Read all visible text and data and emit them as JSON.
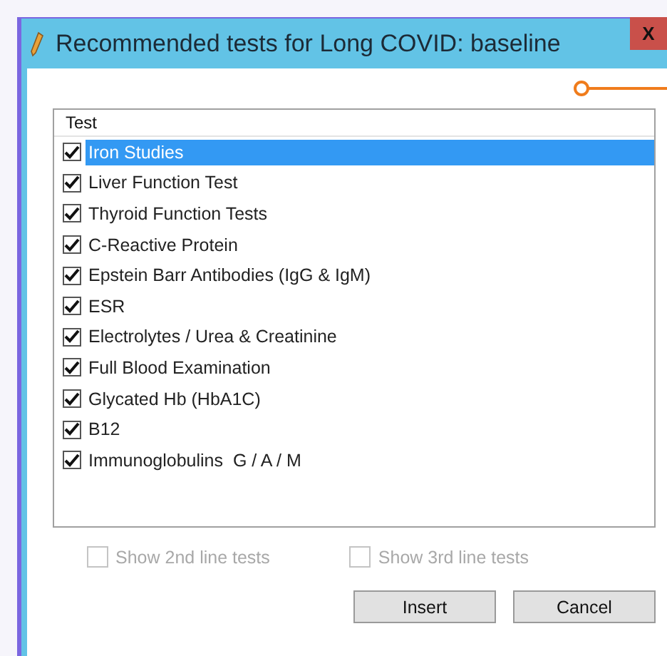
{
  "window": {
    "title": "Recommended tests for Long COVID: baseline",
    "close": "X"
  },
  "list": {
    "column": "Test",
    "items": [
      {
        "label": "Iron Studies",
        "checked": true,
        "selected": true
      },
      {
        "label": "Liver Function Test",
        "checked": true,
        "selected": false
      },
      {
        "label": "Thyroid Function Tests",
        "checked": true,
        "selected": false
      },
      {
        "label": "C-Reactive Protein",
        "checked": true,
        "selected": false
      },
      {
        "label": "Epstein Barr Antibodies (IgG & IgM)",
        "checked": true,
        "selected": false
      },
      {
        "label": "ESR",
        "checked": true,
        "selected": false
      },
      {
        "label": "Electrolytes / Urea & Creatinine",
        "checked": true,
        "selected": false
      },
      {
        "label": "Full Blood Examination",
        "checked": true,
        "selected": false
      },
      {
        "label": "Glycated Hb (HbA1C)",
        "checked": true,
        "selected": false
      },
      {
        "label": "B12",
        "checked": true,
        "selected": false
      },
      {
        "label": "Immunoglobulins  G / A / M",
        "checked": true,
        "selected": false
      }
    ]
  },
  "options": [
    {
      "label": "Show 2nd line tests",
      "checked": false,
      "disabled": true
    },
    {
      "label": "Show 3rd line tests",
      "checked": false,
      "disabled": true
    }
  ],
  "buttons": [
    "Insert",
    "Cancel"
  ]
}
